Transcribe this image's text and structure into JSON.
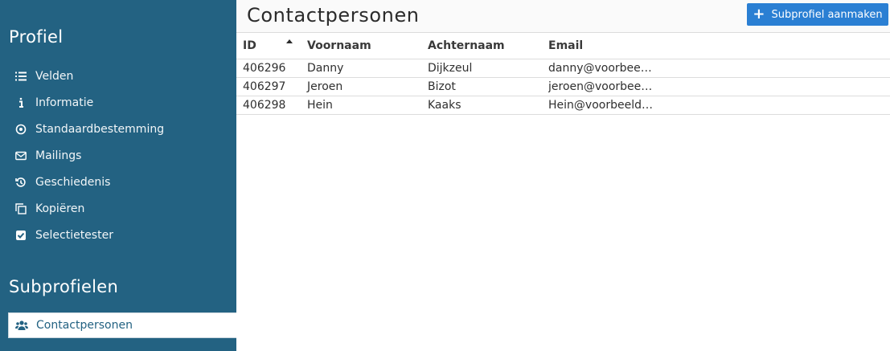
{
  "sidebar": {
    "section_title": "Profiel",
    "items": [
      {
        "label": "Velden",
        "icon": "list-icon"
      },
      {
        "label": "Informatie",
        "icon": "info-icon"
      },
      {
        "label": "Standaardbestemming",
        "icon": "target-icon"
      },
      {
        "label": "Mailings",
        "icon": "envelope-icon"
      },
      {
        "label": "Geschiedenis",
        "icon": "history-icon"
      },
      {
        "label": "Kopiëren",
        "icon": "copy-icon"
      },
      {
        "label": "Selectietester",
        "icon": "checkbox-icon"
      }
    ],
    "sub_section_title": "Subprofielen",
    "sub_items": [
      {
        "label": "Contactpersonen",
        "icon": "users-icon",
        "active": true
      }
    ]
  },
  "main": {
    "title": "Contactpersonen",
    "add_button_label": "Subprofiel aanmaken",
    "table": {
      "columns": [
        "ID",
        "Voornaam",
        "Achternaam",
        "Email"
      ],
      "sorted_column": "ID",
      "sort_direction": "ascending",
      "rows": [
        {
          "id": "406296",
          "voornaam": "Danny",
          "achternaam": "Dijkzeul",
          "email": "danny@voorbeel..."
        },
        {
          "id": "406297",
          "voornaam": "Jeroen",
          "achternaam": "Bizot",
          "email": "jeroen@voorbeel..."
        },
        {
          "id": "406298",
          "voornaam": "Hein",
          "achternaam": "Kaaks",
          "email": "Hein@voorbeeld...."
        }
      ]
    }
  },
  "colors": {
    "sidebar_bg": "#236282",
    "button_bg": "#2a7fd3",
    "topbar_bg": "#fafafa"
  }
}
